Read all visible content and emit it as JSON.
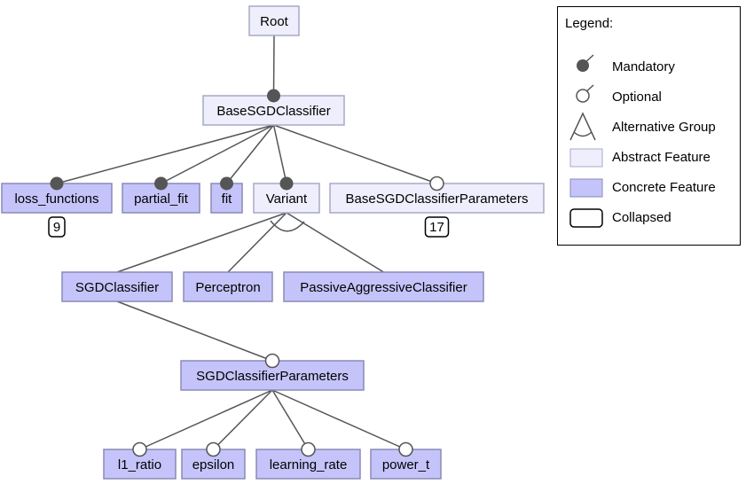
{
  "colors": {
    "abstract_fill": "#eeeefc",
    "abstract_stroke": "#a8a8c8",
    "concrete_fill": "#c4c4fa",
    "concrete_stroke": "#8a8ab8",
    "edge": "#555555",
    "collapsed_stroke": "#000000"
  },
  "nodes": [
    {
      "id": "root",
      "label": "Root",
      "kind": "abstract"
    },
    {
      "id": "base",
      "label": "BaseSGDClassifier",
      "kind": "abstract",
      "parent": "root",
      "relation": "mandatory"
    },
    {
      "id": "loss",
      "label": "loss_functions",
      "kind": "concrete",
      "parent": "base",
      "relation": "mandatory",
      "collapsed": "9"
    },
    {
      "id": "partial",
      "label": "partial_fit",
      "kind": "concrete",
      "parent": "base",
      "relation": "mandatory"
    },
    {
      "id": "fit",
      "label": "fit",
      "kind": "concrete",
      "parent": "base",
      "relation": "mandatory"
    },
    {
      "id": "variant",
      "label": "Variant",
      "kind": "abstract",
      "parent": "base",
      "relation": "mandatory",
      "group": "alternative"
    },
    {
      "id": "baseparams",
      "label": "BaseSGDClassifierParameters",
      "kind": "abstract",
      "parent": "base",
      "relation": "optional",
      "collapsed": "17"
    },
    {
      "id": "sgd",
      "label": "SGDClassifier",
      "kind": "concrete",
      "parent": "variant",
      "relation": "alternative"
    },
    {
      "id": "perc",
      "label": "Perceptron",
      "kind": "concrete",
      "parent": "variant",
      "relation": "alternative"
    },
    {
      "id": "pac",
      "label": "PassiveAggressiveClassifier",
      "kind": "concrete",
      "parent": "variant",
      "relation": "alternative"
    },
    {
      "id": "sgdparams",
      "label": "SGDClassifierParameters",
      "kind": "concrete",
      "parent": "sgd",
      "relation": "optional"
    },
    {
      "id": "l1",
      "label": "l1_ratio",
      "kind": "concrete",
      "parent": "sgdparams",
      "relation": "optional"
    },
    {
      "id": "eps",
      "label": "epsilon",
      "kind": "concrete",
      "parent": "sgdparams",
      "relation": "optional"
    },
    {
      "id": "lr",
      "label": "learning_rate",
      "kind": "concrete",
      "parent": "sgdparams",
      "relation": "optional"
    },
    {
      "id": "pt",
      "label": "power_t",
      "kind": "concrete",
      "parent": "sgdparams",
      "relation": "optional"
    }
  ],
  "legend": {
    "title": "Legend:",
    "items": [
      "Mandatory",
      "Optional",
      "Alternative Group",
      "Abstract Feature",
      "Concrete Feature",
      "Collapsed"
    ]
  }
}
